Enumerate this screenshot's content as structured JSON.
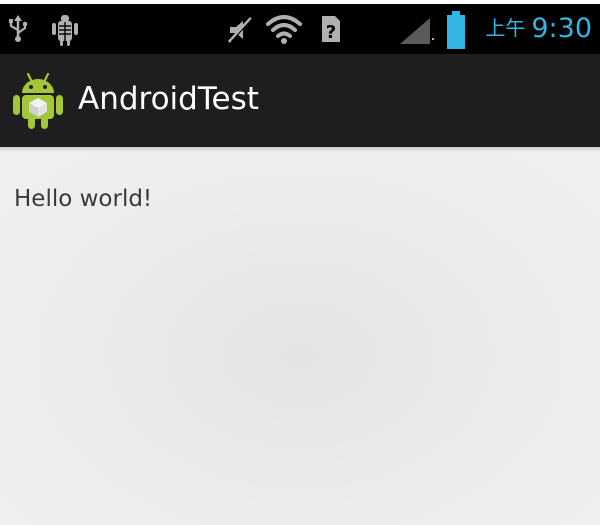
{
  "status_bar": {
    "time": "9:30",
    "ampm": "上午",
    "time_color": "#33b5e5",
    "icons": [
      "usb-icon",
      "debug-icon",
      "mute-icon",
      "wifi-icon",
      "no-sim-icon",
      "signal-icon",
      "battery-icon"
    ]
  },
  "action_bar": {
    "title": "AndroidTest",
    "app_icon": "android-robot-icon"
  },
  "content": {
    "text": "Hello world!"
  },
  "colors": {
    "status_bar": "#000000",
    "action_bar": "#1e1e1e",
    "content_background": "#ececec",
    "android_green": "#a4c639"
  }
}
